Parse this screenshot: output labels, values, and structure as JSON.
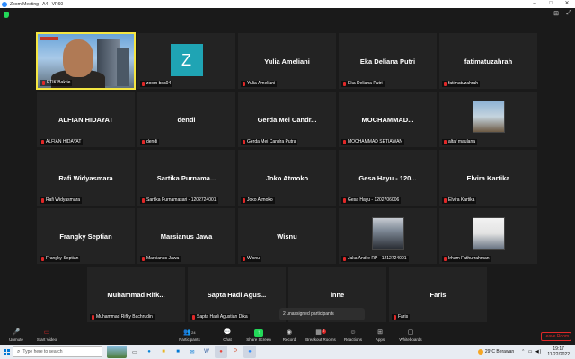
{
  "window": {
    "title": "Zoom Meeting - A4 - VR60"
  },
  "top_controls": {
    "view_label": "⊞",
    "fullscreen_label": "⤢"
  },
  "gallery": {
    "tiles": [
      {
        "id": "t1",
        "big_name": "",
        "label": "FTIK Bakrie",
        "type": "video",
        "active": true
      },
      {
        "id": "t2",
        "big_name": "",
        "label": "zoom bsa04",
        "type": "avatar",
        "avatar_letter": "Z"
      },
      {
        "id": "t3",
        "big_name": "Yulia Ameliani",
        "label": "Yulia Ameliani"
      },
      {
        "id": "t4",
        "big_name": "Eka Deliana Putri",
        "label": "Eka Deliana Putri"
      },
      {
        "id": "t5",
        "big_name": "fatimatuzahrah",
        "label": "fatimatuzahrah"
      },
      {
        "id": "t6",
        "big_name": "ALFIAN HIDAYAT",
        "label": "ALFIAN HIDAYAT"
      },
      {
        "id": "t7",
        "big_name": "dendi",
        "label": "dendi"
      },
      {
        "id": "t8",
        "big_name": "Gerda Mei Candr...",
        "label": "Gerda Mei Candra Putra"
      },
      {
        "id": "t9",
        "big_name": "MOCHAMMAD...",
        "label": "MOCHAMMAD SETIAWAN"
      },
      {
        "id": "t10",
        "big_name": "",
        "label": "altaf maulana",
        "type": "photo",
        "photo_style": "photo-1"
      },
      {
        "id": "t11",
        "big_name": "Rafi Widyasmara",
        "label": "Rafi Widyasmara"
      },
      {
        "id": "t12",
        "big_name": "Sartika Purnama...",
        "label": "Sartika Purnamasari - 1202724001"
      },
      {
        "id": "t13",
        "big_name": "Joko Atmoko",
        "label": "Joko Atmoko"
      },
      {
        "id": "t14",
        "big_name": "Gesa Hayu - 120...",
        "label": "Gesa Hayu - 1202706006"
      },
      {
        "id": "t15",
        "big_name": "Elvira Kartika",
        "label": "Elvira Kartika"
      },
      {
        "id": "t16",
        "big_name": "Frangky Septian",
        "label": "Frangky Septian"
      },
      {
        "id": "t17",
        "big_name": "Marsianus Jawa",
        "label": "Marsianus Jawa"
      },
      {
        "id": "t18",
        "big_name": "Wisnu",
        "label": "Wisnu"
      },
      {
        "id": "t19",
        "big_name": "",
        "label": "Jaka Andre RP - 1212724001",
        "type": "photo",
        "photo_style": "photo-2"
      },
      {
        "id": "t20",
        "big_name": "",
        "label": "Irham Fathurrahman",
        "type": "photo",
        "photo_style": "photo-3"
      },
      {
        "id": "t21",
        "big_name": "Muhammad Rifk...",
        "label": "Muhammad Rifky Bachrudin"
      },
      {
        "id": "t22",
        "big_name": "Sapta Hadi Agus...",
        "label": "Sapta Hadi Agustian Dika"
      },
      {
        "id": "t23",
        "big_name": "inne",
        "label": ""
      },
      {
        "id": "t24",
        "big_name": "Faris",
        "label": "Faris"
      }
    ],
    "unassigned_text": "2 unassigned participants"
  },
  "toolbar": {
    "unmute": "Unmute",
    "start_video": "Start Video",
    "participants": "Participants",
    "participants_count": "24",
    "chat": "Chat",
    "share_screen": "Share Screen",
    "record": "Record",
    "breakout_rooms": "Breakout Rooms",
    "breakout_badge": "2",
    "reactions": "Reactions",
    "apps": "Apps",
    "whiteboards": "Whiteboards",
    "leave_room": "Leave Room"
  },
  "taskbar": {
    "search_placeholder": "Type here to search",
    "weather_temp": "29°C",
    "weather_desc": "Berawan",
    "time": "19:17",
    "date": "11/22/2022"
  },
  "colors": {
    "active_speaker_border": "#f4e542",
    "zoom_blue": "#2d8cff",
    "mute_red": "#e02828",
    "share_green": "#23d959"
  }
}
